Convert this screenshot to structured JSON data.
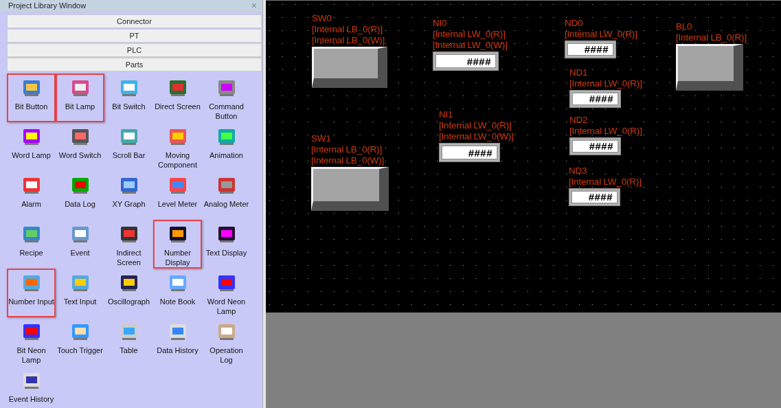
{
  "library": {
    "title": "Project Library Window",
    "close": "×",
    "categories": [
      "Connector",
      "PT",
      "PLC",
      "Parts"
    ],
    "parts": [
      {
        "label": "Bit Button",
        "highlighted": true
      },
      {
        "label": "Bit Lamp",
        "highlighted": true
      },
      {
        "label": "Bit Switch",
        "highlighted": false
      },
      {
        "label": "Direct Screen",
        "highlighted": false
      },
      {
        "label": "Command Button",
        "highlighted": false
      },
      {
        "label": "Word Lamp",
        "highlighted": false
      },
      {
        "label": "Word Switch",
        "highlighted": false
      },
      {
        "label": "Scroll Bar",
        "highlighted": false
      },
      {
        "label": "Moving Component",
        "highlighted": false
      },
      {
        "label": "Animation",
        "highlighted": false
      },
      {
        "label": "Alarm",
        "highlighted": false
      },
      {
        "label": "Data Log",
        "highlighted": false
      },
      {
        "label": "XY Graph",
        "highlighted": false
      },
      {
        "label": "Level Meter",
        "highlighted": false
      },
      {
        "label": "Analog Meter",
        "highlighted": false
      },
      {
        "label": "Recipe",
        "highlighted": false
      },
      {
        "label": "Event",
        "highlighted": false
      },
      {
        "label": "Indirect Screen",
        "highlighted": false
      },
      {
        "label": "Number Display",
        "highlighted": true
      },
      {
        "label": "Text Display",
        "highlighted": false
      },
      {
        "label": "Number Input",
        "highlighted": true
      },
      {
        "label": "Text Input",
        "highlighted": false
      },
      {
        "label": "Oscillograph",
        "highlighted": false
      },
      {
        "label": "Note Book",
        "highlighted": false
      },
      {
        "label": "Word Neon Lamp",
        "highlighted": false
      },
      {
        "label": "Bit Neon Lamp",
        "highlighted": false
      },
      {
        "label": "Touch Trigger",
        "highlighted": false
      },
      {
        "label": "Table",
        "highlighted": false
      },
      {
        "label": "Data History",
        "highlighted": false
      },
      {
        "label": "Operation Log",
        "highlighted": false
      },
      {
        "label": "Event History",
        "highlighted": false
      }
    ]
  },
  "canvas": {
    "objects": [
      {
        "kind": "switch",
        "name": "SW0",
        "addresses": [
          "[Internal LB_0(R)]",
          "[Internal LB_0(W)]"
        ]
      },
      {
        "kind": "number_input",
        "name": "NI0",
        "addresses": [
          "[Internal LW_0(R)]",
          "[Internal LW_0(W)]"
        ],
        "value": "####"
      },
      {
        "kind": "number_display",
        "name": "ND0",
        "addresses": [
          "[Internal LW_0(R)]"
        ],
        "value": "####"
      },
      {
        "kind": "lamp",
        "name": "BL0",
        "addresses": [
          "[Internal LB_0(R)]"
        ]
      },
      {
        "kind": "number_display",
        "name": "ND1",
        "addresses": [
          "[Internal LW_0(R)]"
        ],
        "value": "####"
      },
      {
        "kind": "number_input",
        "name": "NI1",
        "addresses": [
          "[Internal LW_0(R)]",
          "[Internal LW_0(W)]"
        ],
        "value": "####"
      },
      {
        "kind": "number_display",
        "name": "ND2",
        "addresses": [
          "[Internal LW_0(R)]"
        ],
        "value": "####"
      },
      {
        "kind": "switch",
        "name": "SW1",
        "addresses": [
          "[Internal LB_0(R)]",
          "[Internal LB_0(W)]"
        ]
      },
      {
        "kind": "number_display",
        "name": "ND3",
        "addresses": [
          "[Internal LW_0(R)]"
        ],
        "value": "####"
      }
    ]
  }
}
